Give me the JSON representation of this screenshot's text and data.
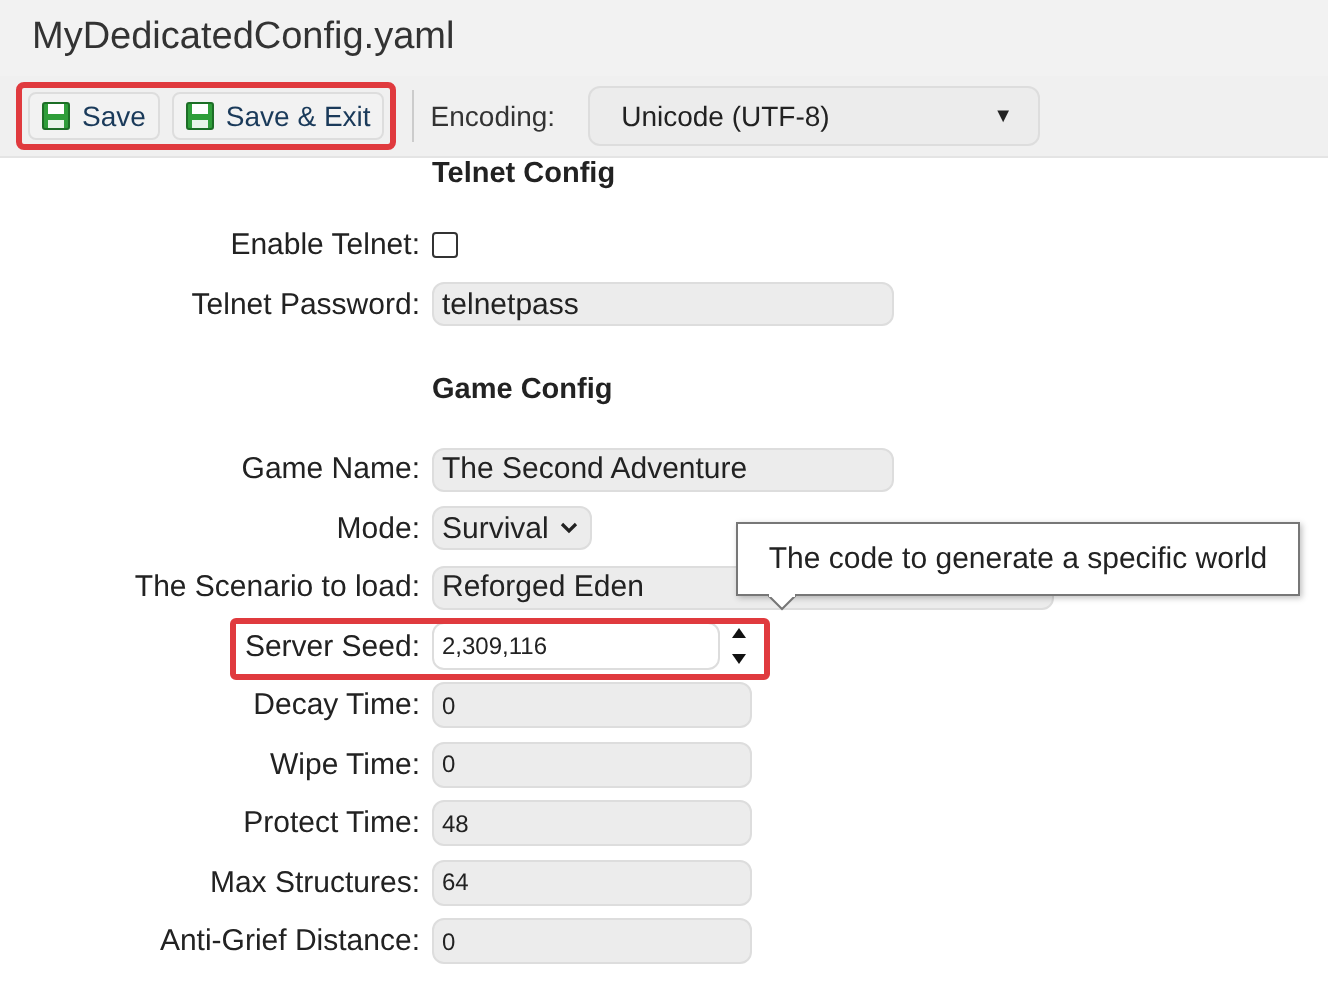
{
  "window": {
    "title": "MyDedicatedConfig.yaml"
  },
  "toolbar": {
    "highlighted": true,
    "buttons": [
      {
        "label": "Save"
      },
      {
        "label": "Save & Exit"
      }
    ],
    "encoding": {
      "label": "Encoding:",
      "value": "Unicode (UTF-8)",
      "arrow": "▼"
    }
  },
  "sections": [
    {
      "heading": "Telnet Config",
      "fields": [
        {
          "label": "Enable Telnet:",
          "kind": "checkbox",
          "checked": false
        },
        {
          "label": "Telnet Password:",
          "kind": "text",
          "value": "telnetpass"
        }
      ]
    },
    {
      "heading": "Game Config",
      "fields": [
        {
          "label": "Game Name:",
          "kind": "text",
          "value": "The Second Adventure"
        },
        {
          "label": "Mode:",
          "kind": "select",
          "value": "Survival"
        },
        {
          "label": "The Scenario to load:",
          "kind": "wide-text",
          "value": "Reforged Eden"
        },
        {
          "label": "Server Seed:",
          "kind": "spin",
          "value": "2,309,116",
          "highlighted": true,
          "tooltip": "The code to generate a specific world"
        },
        {
          "label": "Decay Time:",
          "kind": "short-text",
          "value": "0"
        },
        {
          "label": "Wipe Time:",
          "kind": "short-text",
          "value": "0"
        },
        {
          "label": "Protect Time:",
          "kind": "short-text",
          "value": "48"
        },
        {
          "label": "Max Structures:",
          "kind": "short-text",
          "value": "64"
        },
        {
          "label": "Anti-Grief Distance:",
          "kind": "short-text",
          "value": "0"
        }
      ]
    }
  ]
}
